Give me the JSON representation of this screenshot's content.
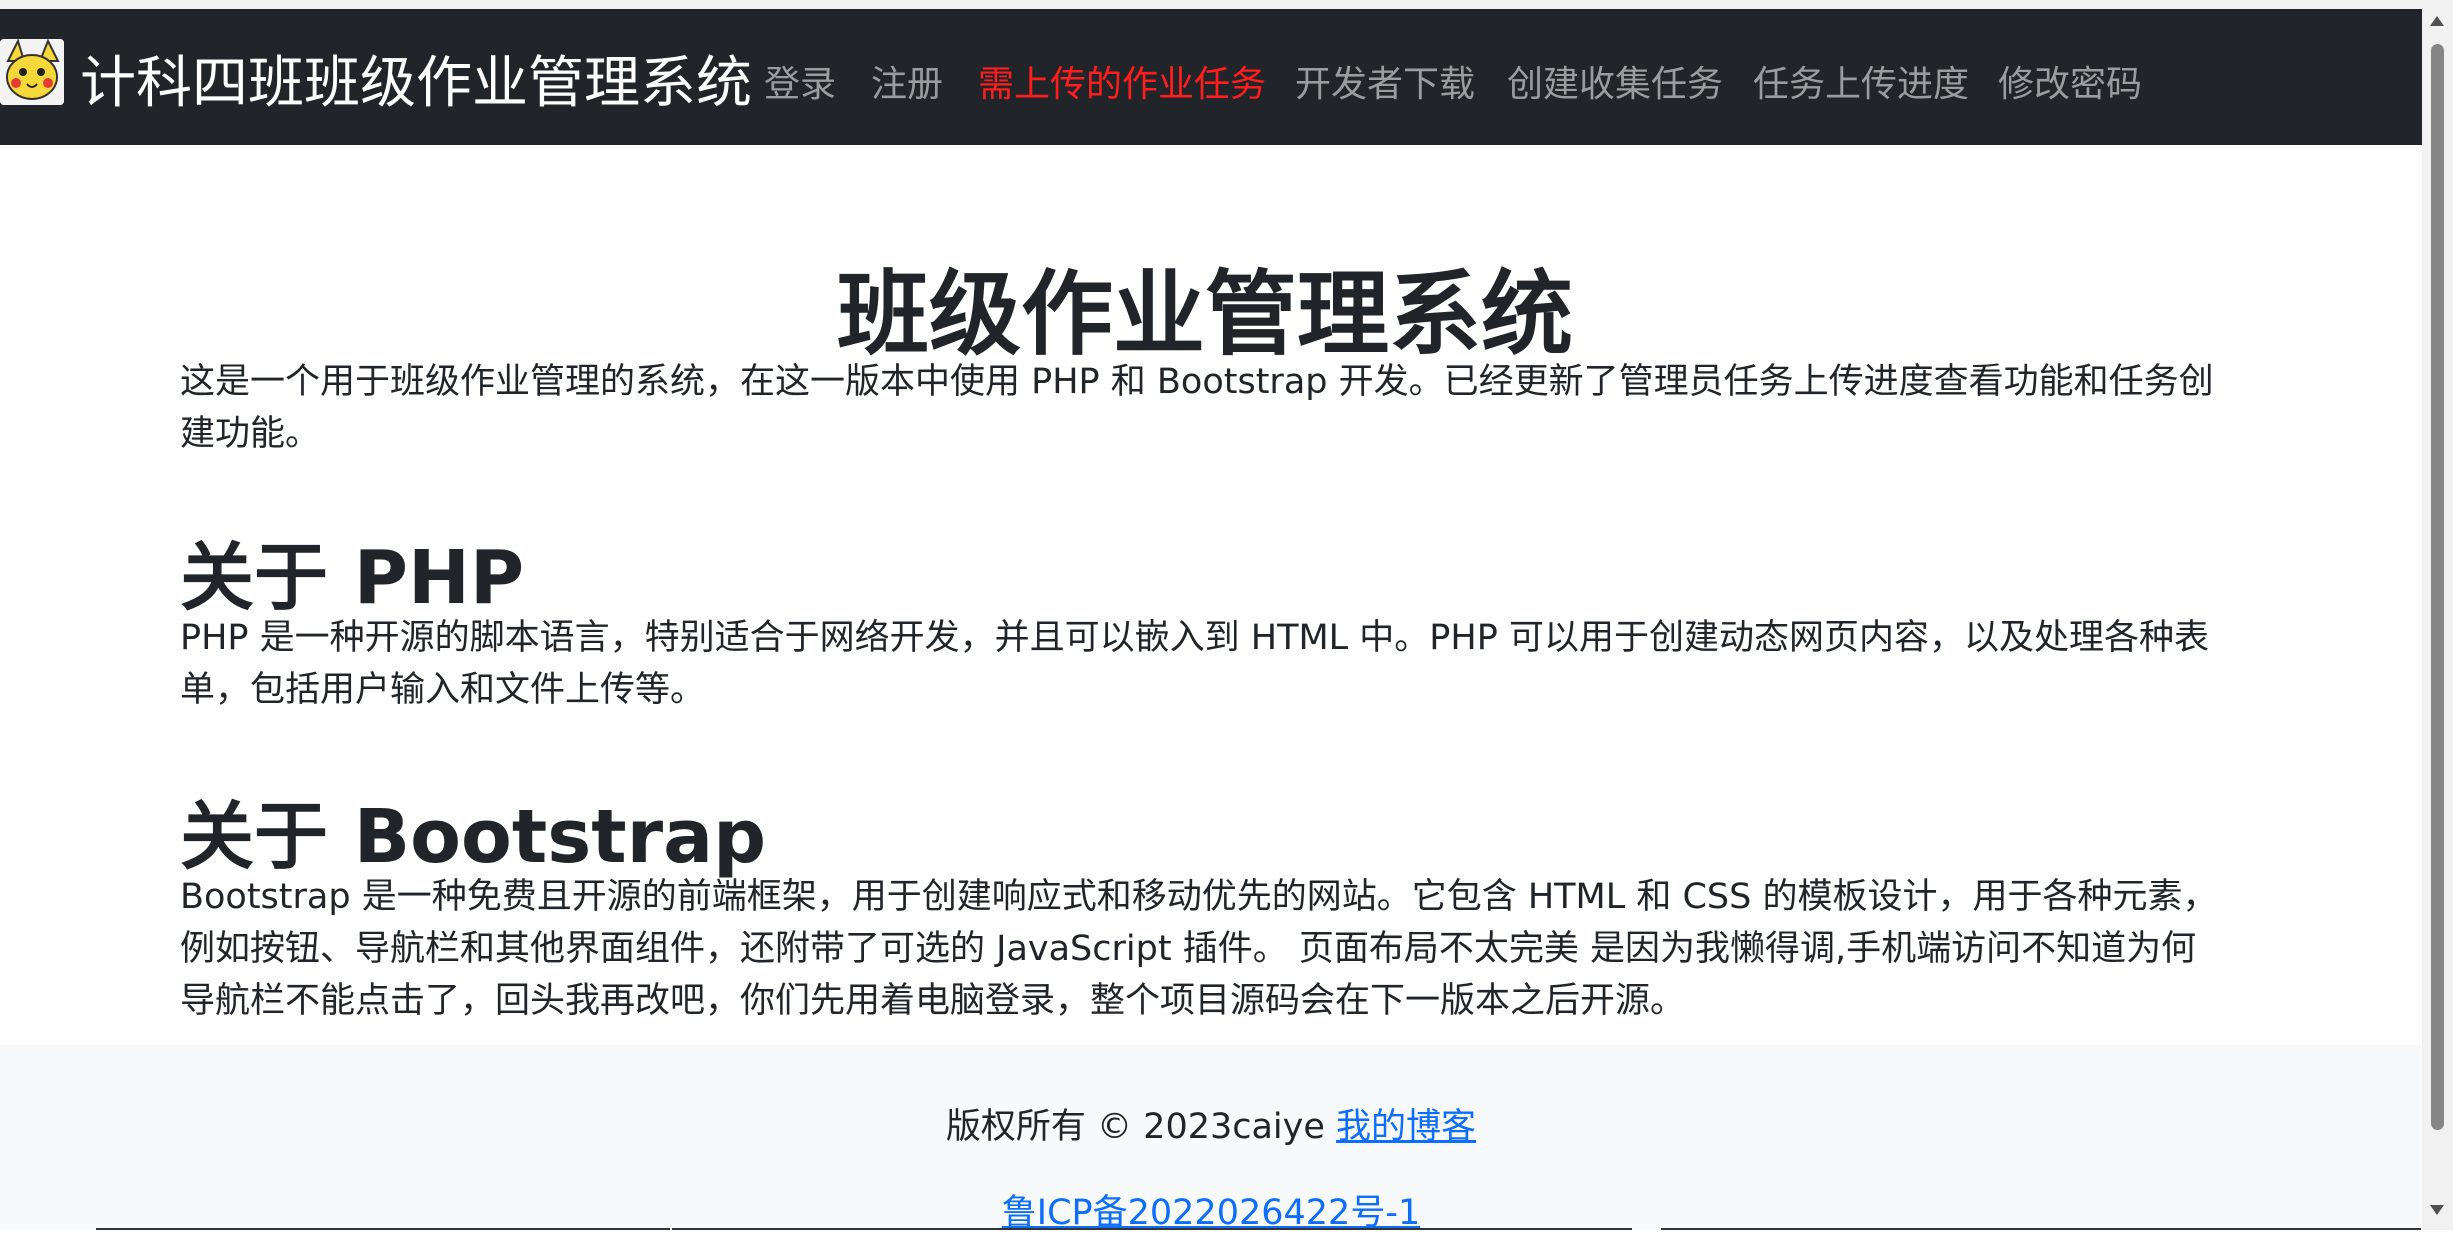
{
  "navbar": {
    "brand": "计科四班班级作业管理系统",
    "items": [
      "登录",
      "注册",
      "需上传的作业任务",
      "开发者下载",
      "创建收集任务",
      "任务上传进度",
      "修改密码"
    ],
    "active_index": 2,
    "logo_icon": "pikachu-avatar-icon"
  },
  "main": {
    "title": "班级作业管理系统",
    "intro": "这是一个用于班级作业管理的系统，在这一版本中使用 PHP 和 Bootstrap 开发。已经更新了管理员任务上传进度查看功能和任务创建功能。",
    "sections": [
      {
        "heading": "关于 PHP",
        "text": "PHP 是一种开源的脚本语言，特别适合于网络开发，并且可以嵌入到 HTML 中。PHP 可以用于创建动态网页内容，以及处理各种表单，包括用户输入和文件上传等。"
      },
      {
        "heading": "关于 Bootstrap",
        "text": "Bootstrap 是一种免费且开源的前端框架，用于创建响应式和移动优先的网站。它包含 HTML 和 CSS 的模板设计，用于各种元素，例如按钮、导航栏和其他界面组件，还附带了可选的 JavaScript 插件。 页面布局不太完美 是因为我懒得调,手机端访问不知道为何导航栏不能点击了，回头我再改吧，你们先用着电脑登录，整个项目源码会在下一版本之后开源。"
      }
    ]
  },
  "footer": {
    "copyright": "版权所有 © 2023caiye ",
    "blog_link": "我的博客",
    "icp": "鲁ICP备2022026422号-1"
  },
  "colors": {
    "navbar_bg": "#212529",
    "active": "#ff1d1d",
    "link": "#0d6efd"
  }
}
